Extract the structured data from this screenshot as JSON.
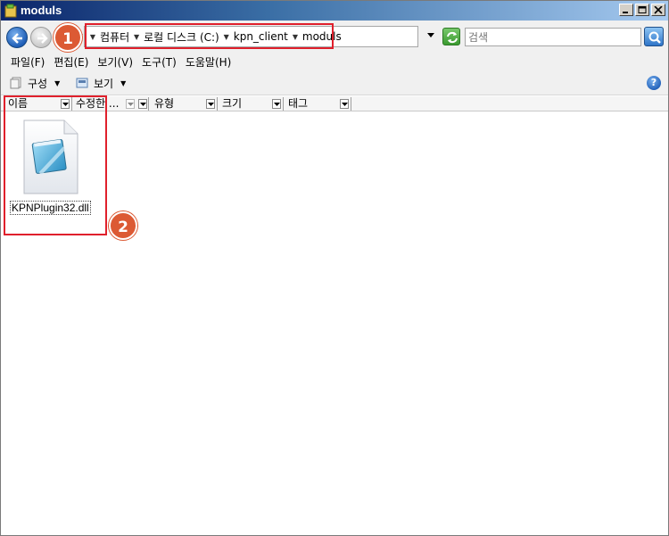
{
  "window": {
    "title": "moduls",
    "title_icon": "folder-icon"
  },
  "address": {
    "breadcrumbs": [
      "컴퓨터",
      "로컬 디스크 (C:)",
      "kpn_client",
      "moduls"
    ],
    "search_placeholder": "검색"
  },
  "menu": {
    "items": [
      "파일(F)",
      "편집(E)",
      "보기(V)",
      "도구(T)",
      "도움말(H)"
    ]
  },
  "toolbar": {
    "organize_label": "구성",
    "view_label": "보기",
    "help_label": "?"
  },
  "columns": [
    "이름",
    "수정한 ...",
    "유형",
    "크기",
    "태그"
  ],
  "files": [
    {
      "name": "KPNPlugin32.dll",
      "icon": "notepad-file-icon"
    }
  ],
  "annotations": [
    {
      "label": "1"
    },
    {
      "label": "2"
    }
  ],
  "colors": {
    "highlight": "#e0202c",
    "badge": "#dc5a34",
    "titlebar": "#0a246a"
  }
}
